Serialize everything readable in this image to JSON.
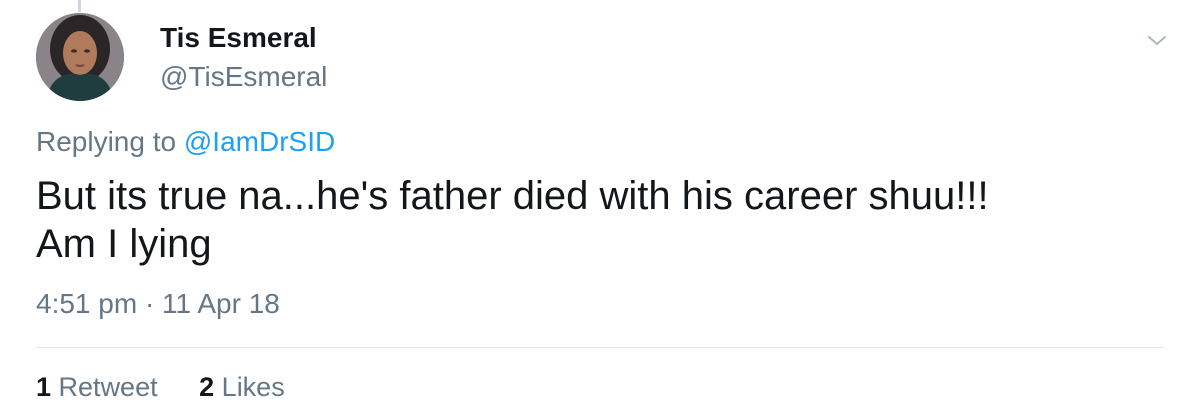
{
  "tweet": {
    "author": {
      "display_name": "Tis Esmeral",
      "handle": "@TisEsmeral"
    },
    "menu_icon": "chevron-down-icon",
    "reply_context": {
      "prefix": "Replying to",
      "mention": "@IamDrSID"
    },
    "text_lines": [
      "But its true na...he's father died with his career shuu!!!",
      "Am I lying"
    ],
    "timestamp": "4:51 pm · 11 Apr 18",
    "stats": {
      "retweets": {
        "count": "1",
        "label": "Retweet"
      },
      "likes": {
        "count": "2",
        "label": "Likes"
      }
    }
  },
  "colors": {
    "text_primary": "#14171a",
    "text_secondary": "#657786",
    "link": "#1da1f2",
    "divider": "#e1e8ed"
  }
}
